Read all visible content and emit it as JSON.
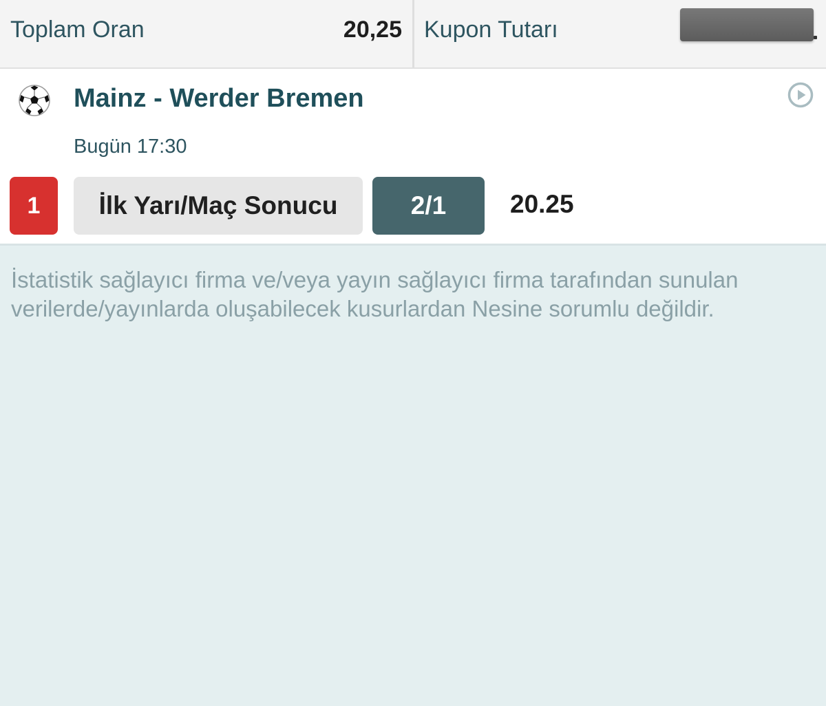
{
  "summary": {
    "total_odds_label": "Toplam Oran",
    "total_odds_value": "20,25",
    "coupon_amount_label": "Kupon Tutarı",
    "coupon_amount_value_hidden": true
  },
  "match": {
    "sport_icon": "soccer-ball-icon",
    "title": "Mainz - Werder Bremen",
    "time": "Bugün 17:30",
    "action_icon": "play-circle-icon",
    "bet": {
      "code": "1",
      "market": "İlk Yarı/Maç Sonucu",
      "selection": "2/1",
      "odd": "20.25"
    }
  },
  "disclaimer": "İstatistik sağlayıcı firma ve/veya yayın sağlayıcı firma tarafından sunulan verilerde/yayınlarda oluşabilecek kusurlardan Nesine sorumlu değildir.",
  "colors": {
    "accent_dark": "#1f4f5a",
    "badge_red": "#d7312f",
    "selection_bg": "#46666c",
    "page_bg": "#e4eff0",
    "disclaimer_text": "#8aa0a6"
  }
}
